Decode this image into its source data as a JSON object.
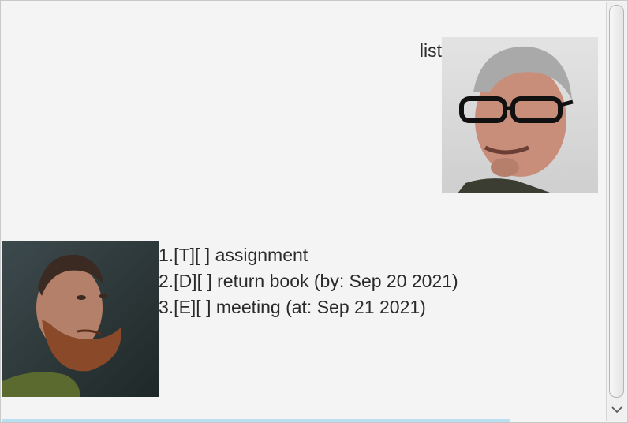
{
  "dialog": {
    "user_message": "list",
    "bot_lines": [
      "1.[T][ ] assignment",
      "2.[D][ ] return book (by: Sep 20 2021)",
      "3.[E][ ] meeting (at: Sep 21 2021)"
    ]
  },
  "avatars": {
    "user": "user-avatar-photo",
    "bot": "bot-avatar-photo"
  },
  "icons": {
    "scroll_down": "chevron-down-icon"
  }
}
